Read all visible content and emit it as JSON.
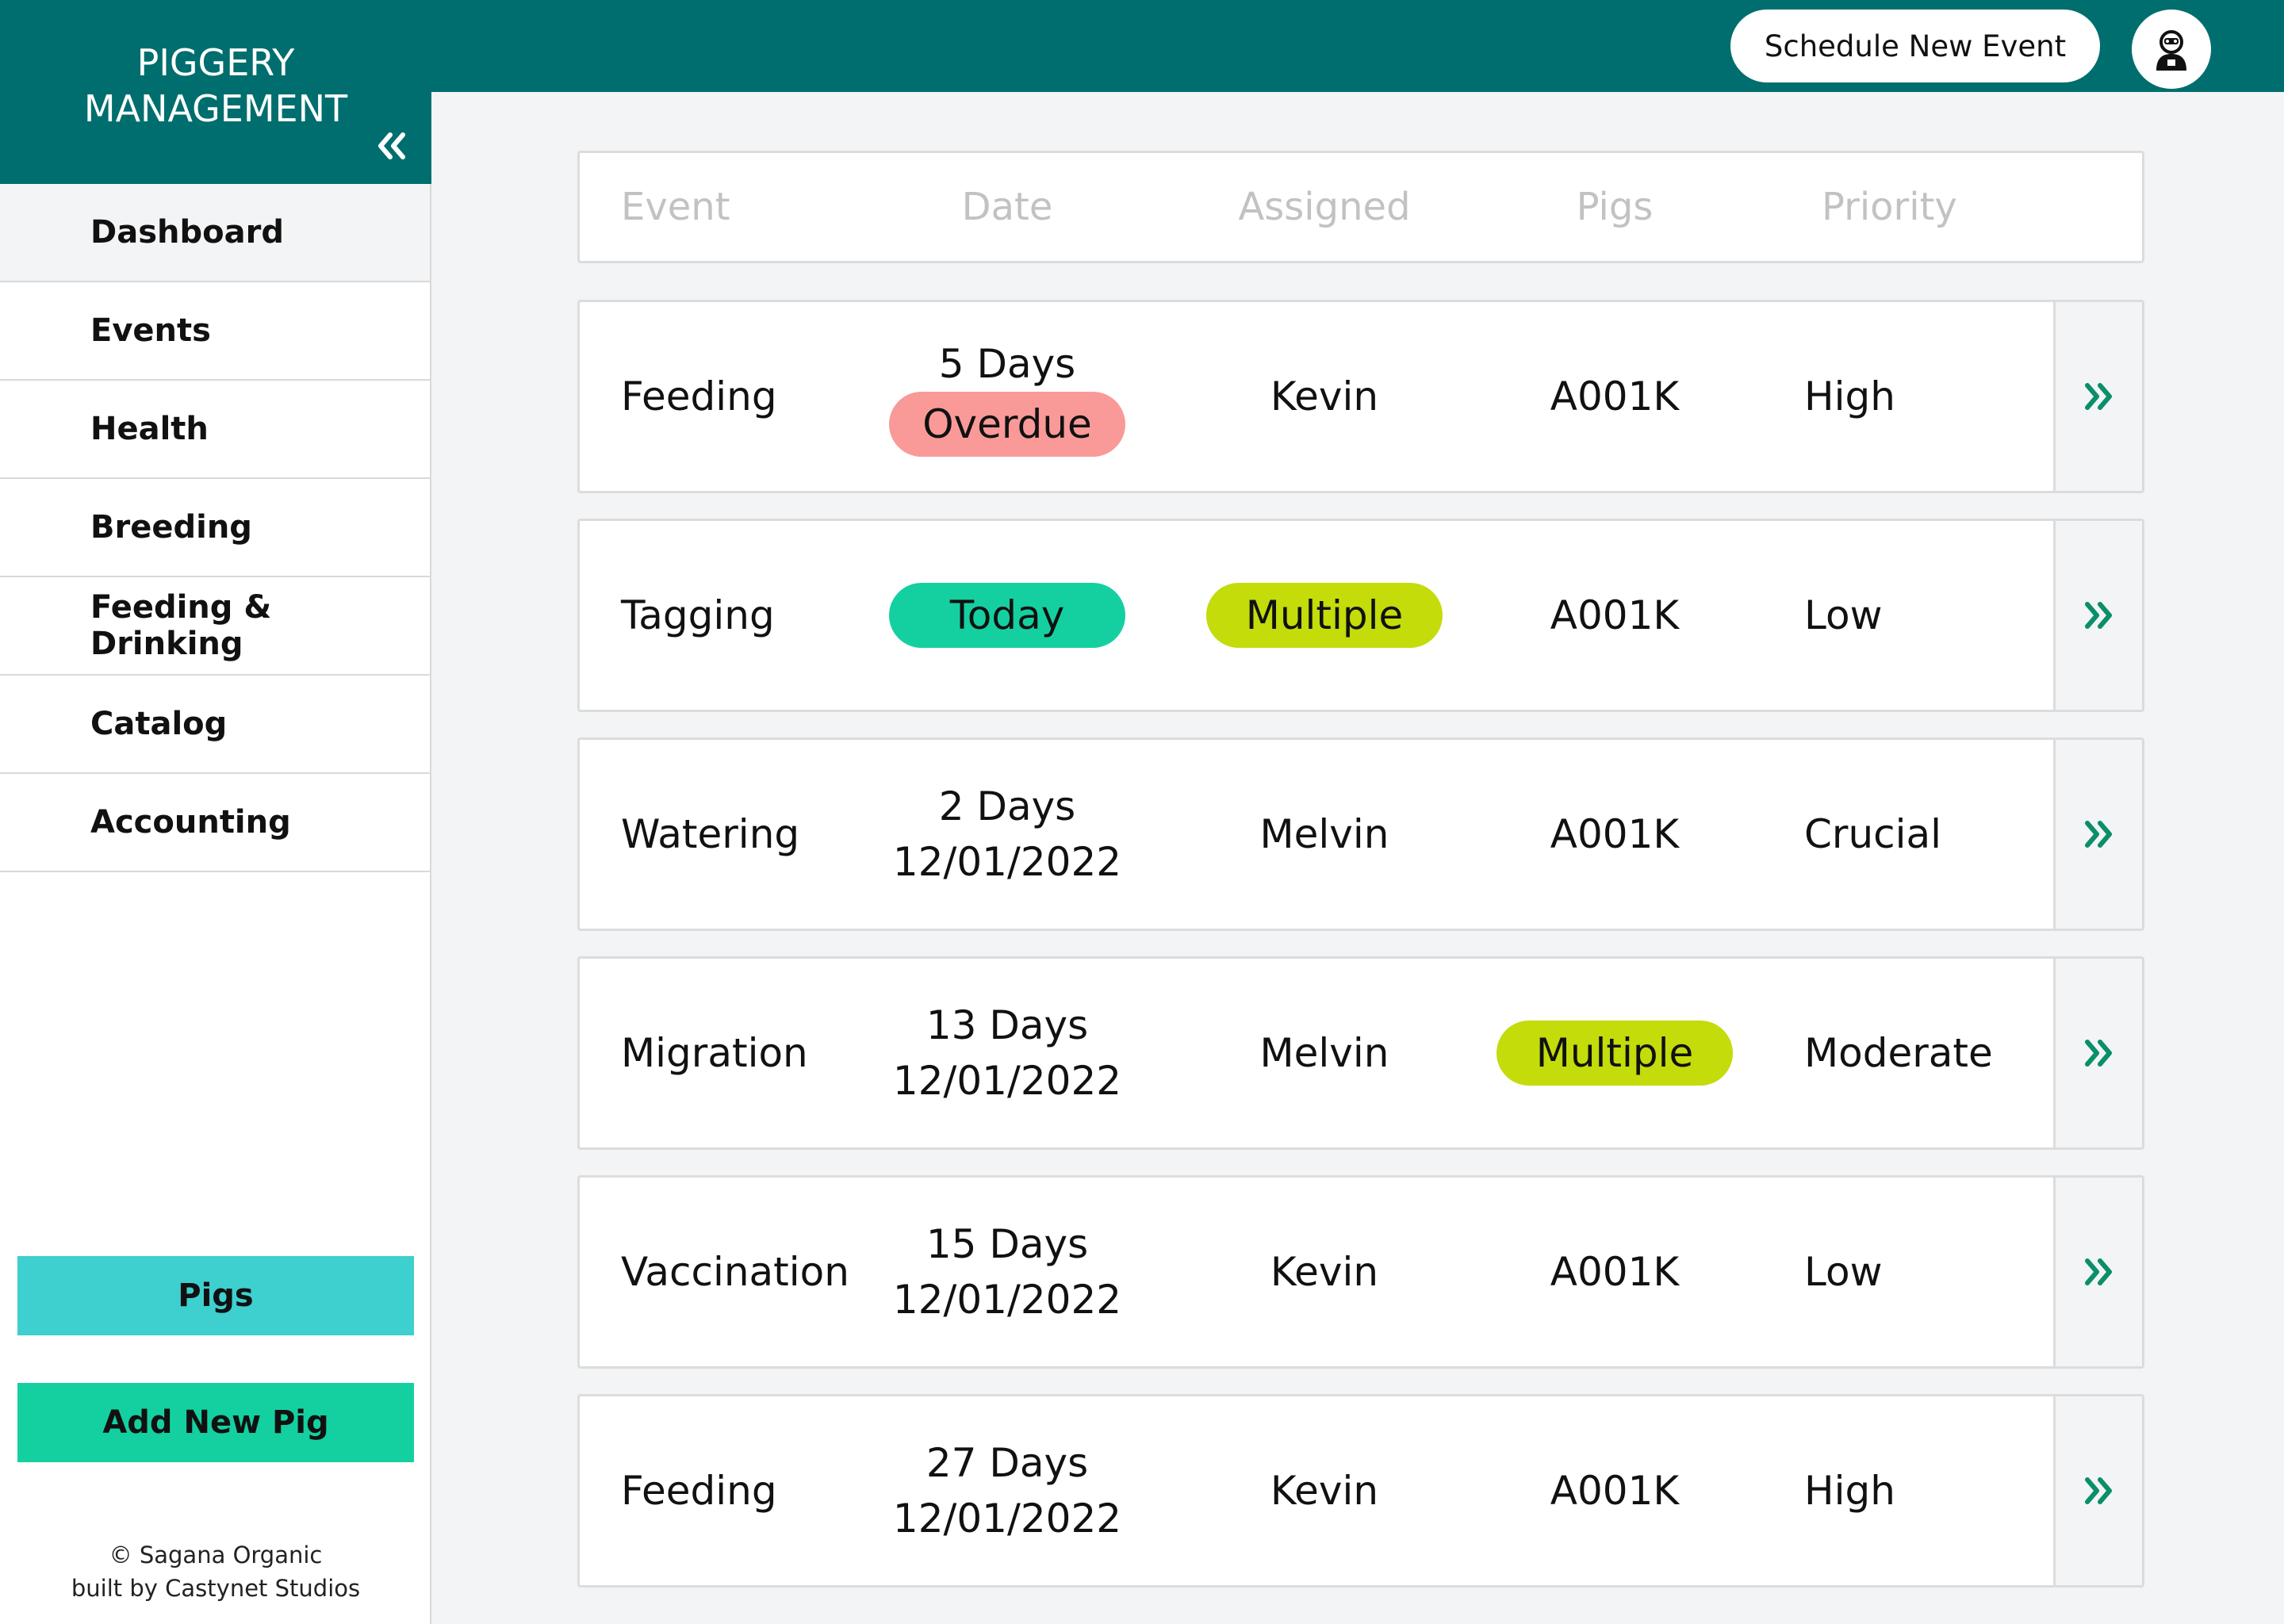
{
  "brand": {
    "line1": "PIGGERY",
    "line2": "MANAGEMENT",
    "collapse_icon": "double-chevron-left-icon"
  },
  "header": {
    "schedule_label": "Schedule New Event",
    "avatar_icon": "user-avatar-icon"
  },
  "sidebar": {
    "items": [
      {
        "label": "Dashboard",
        "active": true
      },
      {
        "label": "Events",
        "active": false
      },
      {
        "label": "Health",
        "active": false
      },
      {
        "label": "Breeding",
        "active": false
      },
      {
        "label": "Feeding & Drinking",
        "active": false
      },
      {
        "label": "Catalog",
        "active": false
      },
      {
        "label": "Accounting",
        "active": false
      }
    ],
    "pigs_label": "Pigs",
    "add_pig_label": "Add New Pig",
    "footer_line1": "© Sagana Organic",
    "footer_line2": "built by Castynet Studios"
  },
  "table": {
    "headers": [
      "Event",
      "Date",
      "Assigned",
      "Pigs",
      "Priority"
    ],
    "rows": [
      {
        "event": "Feeding",
        "date_top": "5 Days",
        "date_bottom": "Overdue",
        "date_bottom_style": "overdue",
        "assigned": "Kevin",
        "assigned_style": "text",
        "pigs": "A001K",
        "pigs_style": "text",
        "priority": "High"
      },
      {
        "event": "Tagging",
        "date_top": "",
        "date_bottom": "Today",
        "date_bottom_style": "today",
        "assigned": "Multiple",
        "assigned_style": "multiple",
        "pigs": "A001K",
        "pigs_style": "text",
        "priority": "Low"
      },
      {
        "event": "Watering",
        "date_top": "2 Days",
        "date_bottom": "12/01/2022",
        "date_bottom_style": "text",
        "assigned": "Melvin",
        "assigned_style": "text",
        "pigs": "A001K",
        "pigs_style": "text",
        "priority": "Crucial"
      },
      {
        "event": "Migration",
        "date_top": "13 Days",
        "date_bottom": "12/01/2022",
        "date_bottom_style": "text",
        "assigned": "Melvin",
        "assigned_style": "text",
        "pigs": "Multiple",
        "pigs_style": "multiple",
        "priority": "Moderate"
      },
      {
        "event": "Vaccination",
        "date_top": "15 Days",
        "date_bottom": "12/01/2022",
        "date_bottom_style": "text",
        "assigned": "Kevin",
        "assigned_style": "text",
        "pigs": "A001K",
        "pigs_style": "text",
        "priority": "Low"
      },
      {
        "event": "Feeding",
        "date_top": "27 Days",
        "date_bottom": "12/01/2022",
        "date_bottom_style": "text",
        "assigned": "Kevin",
        "assigned_style": "text",
        "pigs": "A001K",
        "pigs_style": "text",
        "priority": "High"
      }
    ],
    "row_action_icon": "double-chevron-right-icon"
  },
  "colors": {
    "brand_teal": "#006e6e",
    "overdue": "#f99a98",
    "today": "#14d0a0",
    "multiple": "#c3dc0a",
    "pigs_button": "#3ecfcf",
    "add_button": "#14d0a0"
  }
}
